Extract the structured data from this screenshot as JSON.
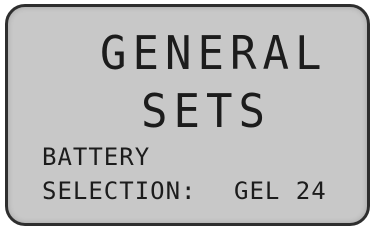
{
  "display": {
    "title_line1": "GENERAL",
    "title_line2": "SETS",
    "setting_label_line1": "BATTERY",
    "setting_label_line2": "SELECTION:",
    "setting_value": "GEL 24"
  }
}
